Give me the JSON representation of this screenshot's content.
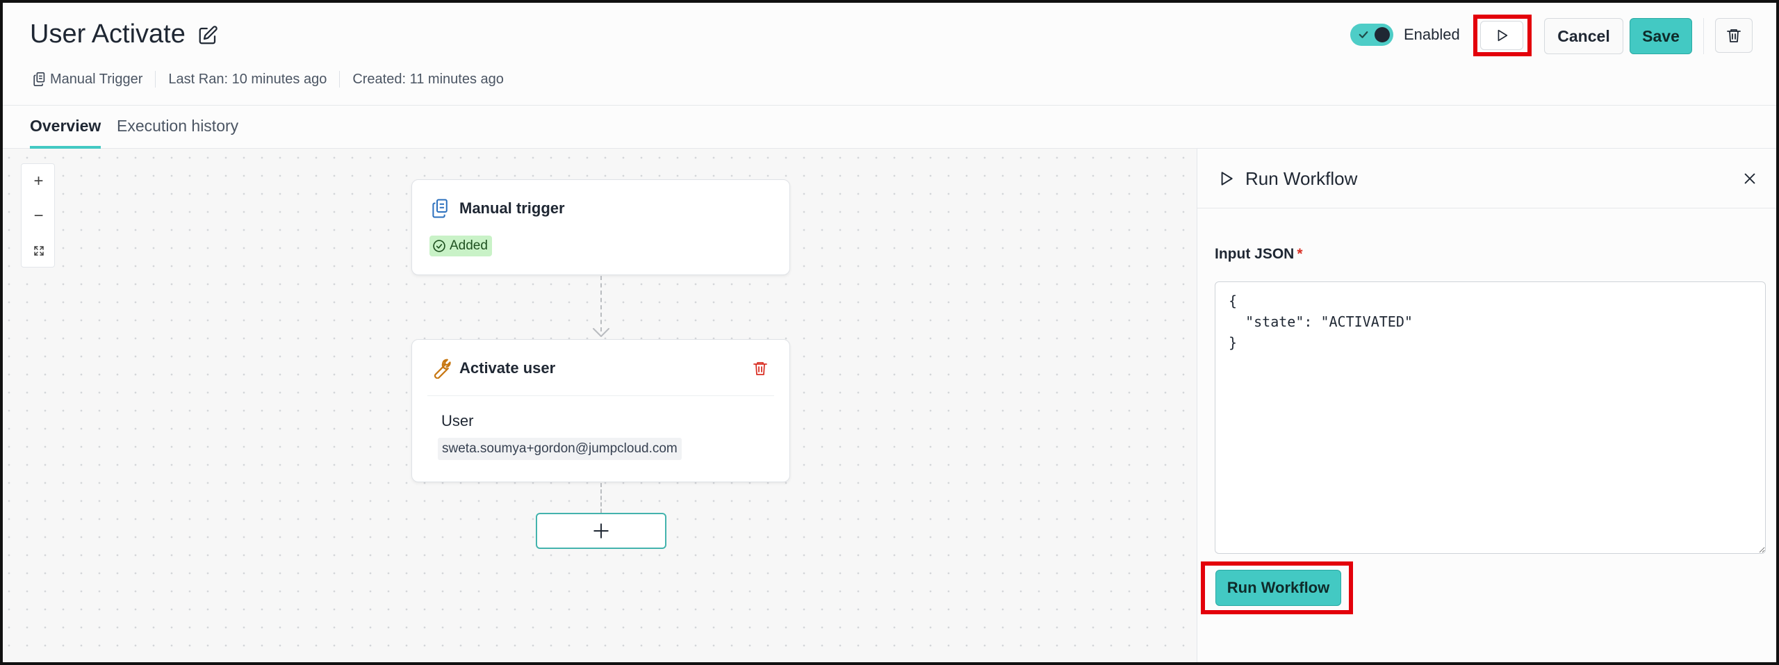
{
  "header": {
    "title": "User Activate",
    "meta": {
      "trigger": "Manual Trigger",
      "last_ran": "Last Ran: 10 minutes ago",
      "created": "Created: 11 minutes ago"
    },
    "toggle": {
      "label": "Enabled",
      "state": "on"
    },
    "cancel_label": "Cancel",
    "save_label": "Save"
  },
  "tabs": [
    {
      "label": "Overview",
      "active": true
    },
    {
      "label": "Execution history",
      "active": false
    }
  ],
  "canvas": {
    "zoom_controls": [
      "+",
      "−"
    ],
    "nodes": [
      {
        "title": "Manual trigger",
        "badge": "Added"
      },
      {
        "title": "Activate user",
        "field_label": "User",
        "field_value": "sweta.soumya+gordon@jumpcloud.com"
      }
    ]
  },
  "panel": {
    "title": "Run Workflow",
    "input_label": "Input JSON",
    "required_mark": "*",
    "input_value": "{\n  \"state\": \"ACTIVATED\"\n}",
    "run_label": "Run Workflow"
  },
  "colors": {
    "accent": "#43c9c3",
    "highlight": "#e3000b",
    "badge_bg": "#c9f2c7",
    "danger": "#d93025"
  }
}
